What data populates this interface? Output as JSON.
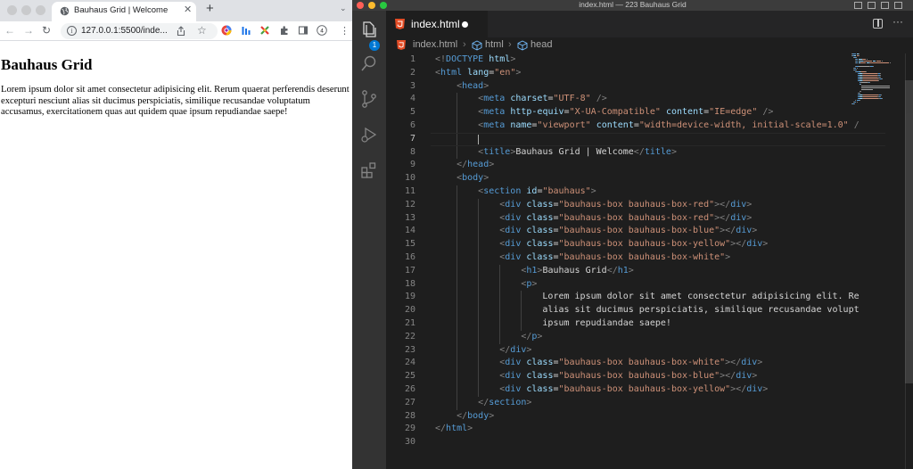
{
  "browser": {
    "tab_title": "Bauhaus Grid | Welcome",
    "tab_close": "✕",
    "new_tab": "+",
    "tab_menu": "⌄",
    "back": "←",
    "forward": "→",
    "reload": "↻",
    "url": "127.0.0.1:5500/inde...",
    "page": {
      "heading": "Bauhaus Grid",
      "paragraph": "Lorem ipsum dolor sit amet consectetur adipisicing elit. Rerum quaerat perferendis deserunt excepturi nesciunt alias sit ducimus perspiciatis, similique recusandae voluptatum accusamus, exercitationem quas aut quidem quae ipsum repudiandae saepe!"
    }
  },
  "vscode": {
    "window_title": "index.html — 223 Bauhaus Grid",
    "badge_count": "1",
    "tab_label": "index.html",
    "more": "···",
    "breadcrumbs": [
      "index.html",
      "html",
      "head"
    ],
    "active_line": 7,
    "lines": [
      [
        [
          "k-br",
          "<!"
        ],
        [
          "k-tag",
          "DOCTYPE"
        ],
        [
          "k-txt",
          " "
        ],
        [
          "k-attr",
          "html"
        ],
        [
          "k-br",
          ">"
        ]
      ],
      [
        [
          "k-br",
          "<"
        ],
        [
          "k-tag",
          "html"
        ],
        [
          "k-txt",
          " "
        ],
        [
          "k-attr",
          "lang"
        ],
        [
          "k-txt",
          "="
        ],
        [
          "k-str",
          "\"en\""
        ],
        [
          "k-br",
          ">"
        ]
      ],
      [
        [
          "k-txt",
          "    "
        ],
        [
          "k-br",
          "<"
        ],
        [
          "k-tag",
          "head"
        ],
        [
          "k-br",
          ">"
        ]
      ],
      [
        [
          "k-txt",
          "        "
        ],
        [
          "k-br",
          "<"
        ],
        [
          "k-tag",
          "meta"
        ],
        [
          "k-txt",
          " "
        ],
        [
          "k-attr",
          "charset"
        ],
        [
          "k-txt",
          "="
        ],
        [
          "k-str",
          "\"UTF-8\""
        ],
        [
          "k-txt",
          " "
        ],
        [
          "k-br",
          "/>"
        ]
      ],
      [
        [
          "k-txt",
          "        "
        ],
        [
          "k-br",
          "<"
        ],
        [
          "k-tag",
          "meta"
        ],
        [
          "k-txt",
          " "
        ],
        [
          "k-attr",
          "http-equiv"
        ],
        [
          "k-txt",
          "="
        ],
        [
          "k-str",
          "\"X-UA-Compatible\""
        ],
        [
          "k-txt",
          " "
        ],
        [
          "k-attr",
          "content"
        ],
        [
          "k-txt",
          "="
        ],
        [
          "k-str",
          "\"IE=edge\""
        ],
        [
          "k-txt",
          " "
        ],
        [
          "k-br",
          "/>"
        ]
      ],
      [
        [
          "k-txt",
          "        "
        ],
        [
          "k-br",
          "<"
        ],
        [
          "k-tag",
          "meta"
        ],
        [
          "k-txt",
          " "
        ],
        [
          "k-attr",
          "name"
        ],
        [
          "k-txt",
          "="
        ],
        [
          "k-str",
          "\"viewport\""
        ],
        [
          "k-txt",
          " "
        ],
        [
          "k-attr",
          "content"
        ],
        [
          "k-txt",
          "="
        ],
        [
          "k-str",
          "\"width=device-width, initial-scale=1.0\""
        ],
        [
          "k-txt",
          " "
        ],
        [
          "k-br",
          "/"
        ]
      ],
      [],
      [
        [
          "k-txt",
          "        "
        ],
        [
          "k-br",
          "<"
        ],
        [
          "k-tag",
          "title"
        ],
        [
          "k-br",
          ">"
        ],
        [
          "k-txt",
          "Bauhaus Grid | Welcome"
        ],
        [
          "k-br",
          "</"
        ],
        [
          "k-tag",
          "title"
        ],
        [
          "k-br",
          ">"
        ]
      ],
      [
        [
          "k-txt",
          "    "
        ],
        [
          "k-br",
          "</"
        ],
        [
          "k-tag",
          "head"
        ],
        [
          "k-br",
          ">"
        ]
      ],
      [
        [
          "k-txt",
          "    "
        ],
        [
          "k-br",
          "<"
        ],
        [
          "k-tag",
          "body"
        ],
        [
          "k-br",
          ">"
        ]
      ],
      [
        [
          "k-txt",
          "        "
        ],
        [
          "k-br",
          "<"
        ],
        [
          "k-tag",
          "section"
        ],
        [
          "k-txt",
          " "
        ],
        [
          "k-attr",
          "id"
        ],
        [
          "k-txt",
          "="
        ],
        [
          "k-str",
          "\"bauhaus\""
        ],
        [
          "k-br",
          ">"
        ]
      ],
      [
        [
          "k-txt",
          "            "
        ],
        [
          "k-br",
          "<"
        ],
        [
          "k-tag",
          "div"
        ],
        [
          "k-txt",
          " "
        ],
        [
          "k-attr",
          "class"
        ],
        [
          "k-txt",
          "="
        ],
        [
          "k-str",
          "\"bauhaus-box bauhaus-box-red\""
        ],
        [
          "k-br",
          "></"
        ],
        [
          "k-tag",
          "div"
        ],
        [
          "k-br",
          ">"
        ]
      ],
      [
        [
          "k-txt",
          "            "
        ],
        [
          "k-br",
          "<"
        ],
        [
          "k-tag",
          "div"
        ],
        [
          "k-txt",
          " "
        ],
        [
          "k-attr",
          "class"
        ],
        [
          "k-txt",
          "="
        ],
        [
          "k-str",
          "\"bauhaus-box bauhaus-box-red\""
        ],
        [
          "k-br",
          "></"
        ],
        [
          "k-tag",
          "div"
        ],
        [
          "k-br",
          ">"
        ]
      ],
      [
        [
          "k-txt",
          "            "
        ],
        [
          "k-br",
          "<"
        ],
        [
          "k-tag",
          "div"
        ],
        [
          "k-txt",
          " "
        ],
        [
          "k-attr",
          "class"
        ],
        [
          "k-txt",
          "="
        ],
        [
          "k-str",
          "\"bauhaus-box bauhaus-box-blue\""
        ],
        [
          "k-br",
          "></"
        ],
        [
          "k-tag",
          "div"
        ],
        [
          "k-br",
          ">"
        ]
      ],
      [
        [
          "k-txt",
          "            "
        ],
        [
          "k-br",
          "<"
        ],
        [
          "k-tag",
          "div"
        ],
        [
          "k-txt",
          " "
        ],
        [
          "k-attr",
          "class"
        ],
        [
          "k-txt",
          "="
        ],
        [
          "k-str",
          "\"bauhaus-box bauhaus-box-yellow\""
        ],
        [
          "k-br",
          "></"
        ],
        [
          "k-tag",
          "div"
        ],
        [
          "k-br",
          ">"
        ]
      ],
      [
        [
          "k-txt",
          "            "
        ],
        [
          "k-br",
          "<"
        ],
        [
          "k-tag",
          "div"
        ],
        [
          "k-txt",
          " "
        ],
        [
          "k-attr",
          "class"
        ],
        [
          "k-txt",
          "="
        ],
        [
          "k-str",
          "\"bauhaus-box bauhaus-box-white\""
        ],
        [
          "k-br",
          ">"
        ]
      ],
      [
        [
          "k-txt",
          "                "
        ],
        [
          "k-br",
          "<"
        ],
        [
          "k-tag",
          "h1"
        ],
        [
          "k-br",
          ">"
        ],
        [
          "k-txt",
          "Bauhaus Grid"
        ],
        [
          "k-br",
          "</"
        ],
        [
          "k-tag",
          "h1"
        ],
        [
          "k-br",
          ">"
        ]
      ],
      [
        [
          "k-txt",
          "                "
        ],
        [
          "k-br",
          "<"
        ],
        [
          "k-tag",
          "p"
        ],
        [
          "k-br",
          ">"
        ]
      ],
      [
        [
          "k-txt",
          "                    Lorem ipsum dolor sit amet consectetur adipisicing elit. Re"
        ]
      ],
      [
        [
          "k-txt",
          "                    alias sit ducimus perspiciatis, similique recusandae volupt"
        ]
      ],
      [
        [
          "k-txt",
          "                    ipsum repudiandae saepe!"
        ]
      ],
      [
        [
          "k-txt",
          "                "
        ],
        [
          "k-br",
          "</"
        ],
        [
          "k-tag",
          "p"
        ],
        [
          "k-br",
          ">"
        ]
      ],
      [
        [
          "k-txt",
          "            "
        ],
        [
          "k-br",
          "</"
        ],
        [
          "k-tag",
          "div"
        ],
        [
          "k-br",
          ">"
        ]
      ],
      [
        [
          "k-txt",
          "            "
        ],
        [
          "k-br",
          "<"
        ],
        [
          "k-tag",
          "div"
        ],
        [
          "k-txt",
          " "
        ],
        [
          "k-attr",
          "class"
        ],
        [
          "k-txt",
          "="
        ],
        [
          "k-str",
          "\"bauhaus-box bauhaus-box-white\""
        ],
        [
          "k-br",
          "></"
        ],
        [
          "k-tag",
          "div"
        ],
        [
          "k-br",
          ">"
        ]
      ],
      [
        [
          "k-txt",
          "            "
        ],
        [
          "k-br",
          "<"
        ],
        [
          "k-tag",
          "div"
        ],
        [
          "k-txt",
          " "
        ],
        [
          "k-attr",
          "class"
        ],
        [
          "k-txt",
          "="
        ],
        [
          "k-str",
          "\"bauhaus-box bauhaus-box-blue\""
        ],
        [
          "k-br",
          "></"
        ],
        [
          "k-tag",
          "div"
        ],
        [
          "k-br",
          ">"
        ]
      ],
      [
        [
          "k-txt",
          "            "
        ],
        [
          "k-br",
          "<"
        ],
        [
          "k-tag",
          "div"
        ],
        [
          "k-txt",
          " "
        ],
        [
          "k-attr",
          "class"
        ],
        [
          "k-txt",
          "="
        ],
        [
          "k-str",
          "\"bauhaus-box bauhaus-box-yellow\""
        ],
        [
          "k-br",
          "></"
        ],
        [
          "k-tag",
          "div"
        ],
        [
          "k-br",
          ">"
        ]
      ],
      [
        [
          "k-txt",
          "        "
        ],
        [
          "k-br",
          "</"
        ],
        [
          "k-tag",
          "section"
        ],
        [
          "k-br",
          ">"
        ]
      ],
      [
        [
          "k-txt",
          "    "
        ],
        [
          "k-br",
          "</"
        ],
        [
          "k-tag",
          "body"
        ],
        [
          "k-br",
          ">"
        ]
      ],
      [
        [
          "k-br",
          "</"
        ],
        [
          "k-tag",
          "html"
        ],
        [
          "k-br",
          ">"
        ]
      ],
      []
    ]
  }
}
